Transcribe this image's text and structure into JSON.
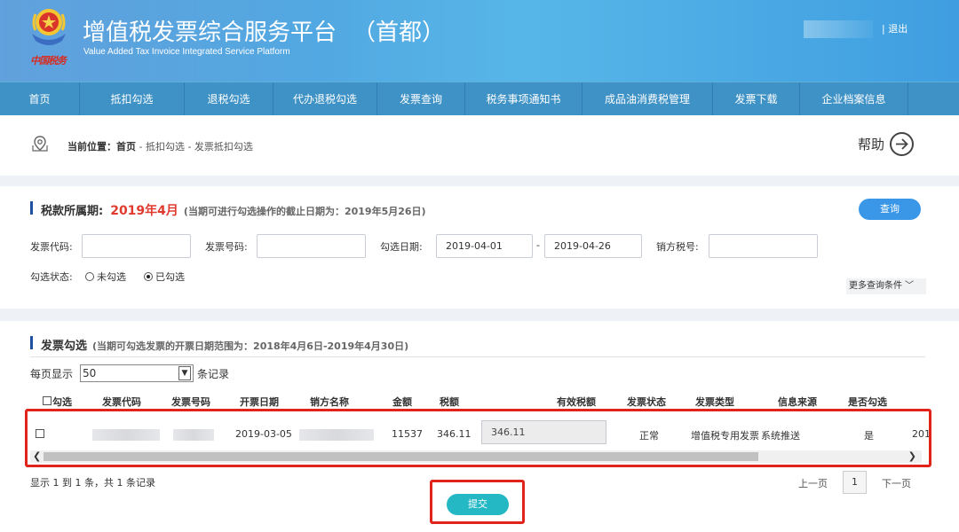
{
  "header": {
    "title": "增值税发票综合服务平台",
    "title_suffix": "（首都）",
    "subtitle": "Value Added Tax Invoice Integrated Service Platform",
    "brand": "中国税务",
    "logout": "| 退出"
  },
  "nav": {
    "items": [
      "首页",
      "抵扣勾选",
      "退税勾选",
      "代办退税勾选",
      "发票查询",
      "税务事项通知书",
      "成品油消费税管理",
      "发票下载",
      "企业档案信息"
    ]
  },
  "breadcrumb": {
    "label": "当前位置：",
    "home": "首页",
    "path": " - 抵扣勾选 - 发票抵扣勾选",
    "help": "帮助"
  },
  "query": {
    "period_label": "税款所属期:",
    "period_value": "2019年4月",
    "period_note": "(当期可进行勾选操作的截止日期为：2019年5月26日)",
    "search_button": "查询",
    "invoice_code_label": "发票代码:",
    "invoice_code_value": "",
    "invoice_no_label": "发票号码:",
    "invoice_no_value": "",
    "select_date_label": "勾选日期:",
    "date_from": "2019-04-01",
    "date_sep": "-",
    "date_to": "2019-04-26",
    "seller_tax_label": "销方税号:",
    "seller_tax_value": "",
    "status_label": "勾选状态:",
    "status_option_unselected": "未勾选",
    "status_option_selected": "已勾选",
    "more_conditions": "更多查询条件 ﹀"
  },
  "invoice_section": {
    "title": "发票勾选",
    "note": "(当期可勾选发票的开票日期范围为：2018年4月6日-2019年4月30日)",
    "per_page_label": "每页显示",
    "per_page_value": "50",
    "records_label": "条记录",
    "columns": [
      "勾选",
      "发票代码",
      "发票号码",
      "开票日期",
      "销方名称",
      "金额",
      "税额",
      "有效税额",
      "发票状态",
      "发票类型",
      "信息来源",
      "是否勾选"
    ],
    "rows": [
      {
        "date": "2019-03-05",
        "amount": "11537",
        "tax": "346.11",
        "valid_tax": "346.11",
        "status": "正常",
        "type": "增值税专用发票",
        "source": "系统推送",
        "selected": "是",
        "overflow": "201"
      }
    ],
    "summary": "显示 1 到 1 条，共 1 条记录",
    "prev": "上一页",
    "page": "1",
    "next": "下一页",
    "submit": "提交"
  },
  "colors": {
    "header_blue": "#4b94d8",
    "nav_blue": "#3f92c6",
    "accent_red": "#e03a2f",
    "query_btn": "#3a97e8",
    "submit_btn": "#24b8c4",
    "highlight_box": "#e2231a"
  }
}
